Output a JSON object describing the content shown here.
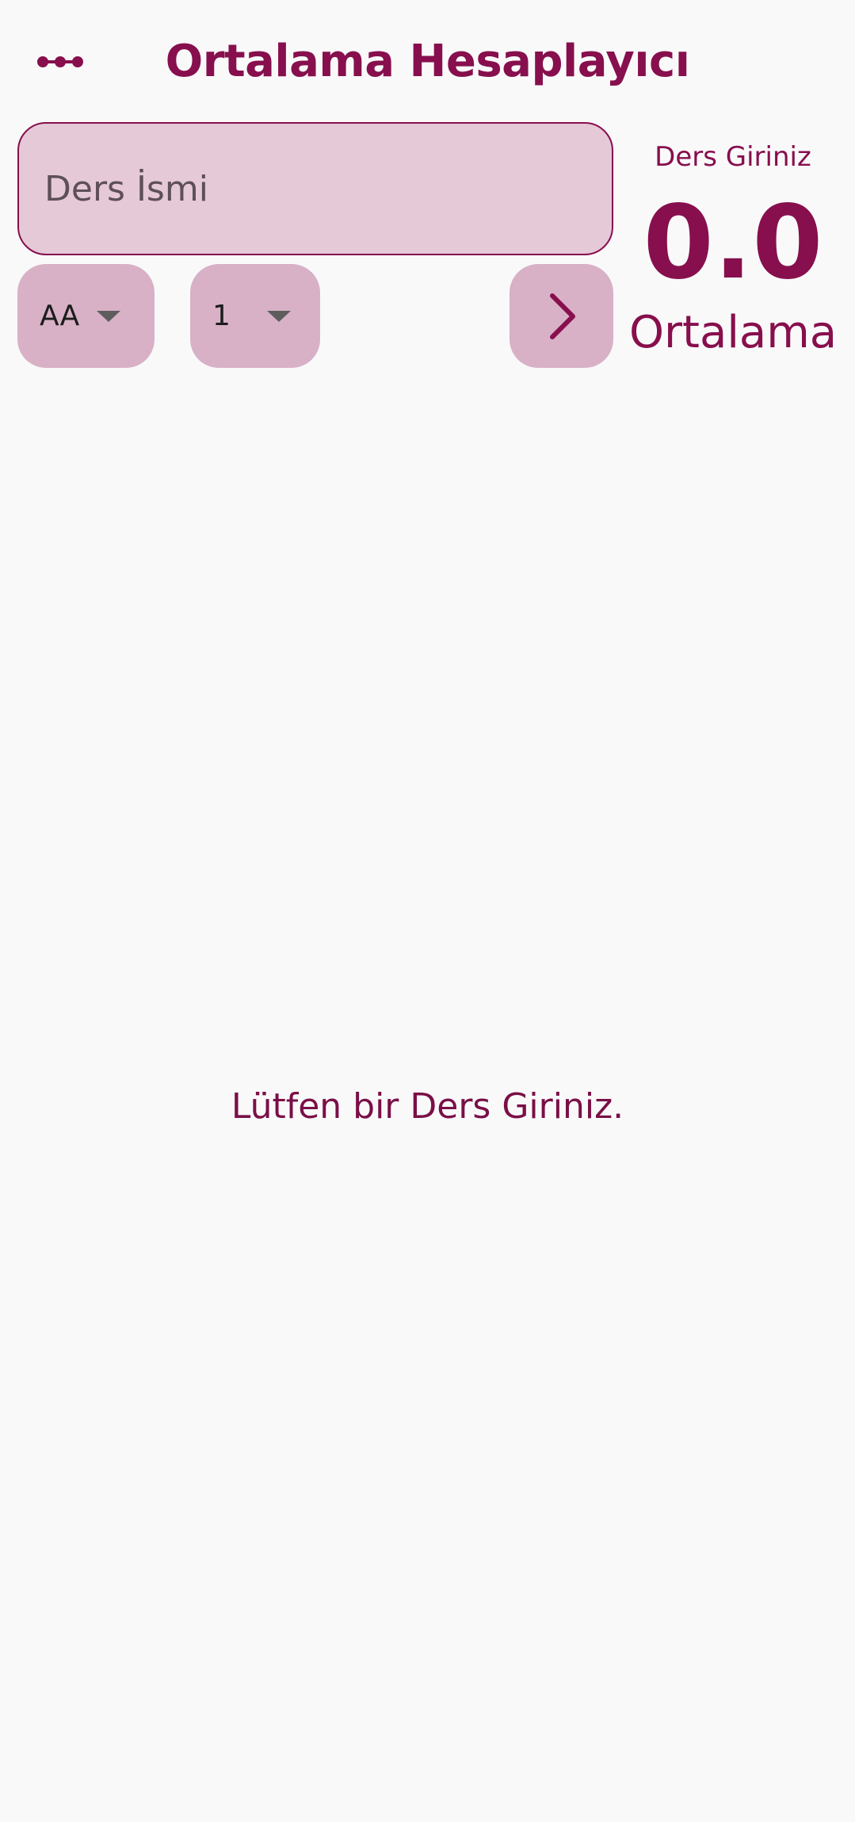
{
  "app": {
    "title": "Ortalama Hesaplayıcı",
    "menu_icon": "more-dots-icon",
    "accent_color": "#870f4d"
  },
  "form": {
    "course_name": {
      "placeholder": "Ders İsmi",
      "value": ""
    },
    "grade_select": {
      "selected": "AA",
      "icon": "dropdown-arrow-icon"
    },
    "credit_select": {
      "selected": "1",
      "icon": "dropdown-arrow-icon"
    },
    "add_button": {
      "icon": "chevron-right-icon"
    }
  },
  "summary": {
    "prompt": "Ders Giriniz",
    "average": "0.0",
    "label": "Ortalama"
  },
  "course_list": {
    "empty_message": "Lütfen bir Ders Giriniz."
  }
}
